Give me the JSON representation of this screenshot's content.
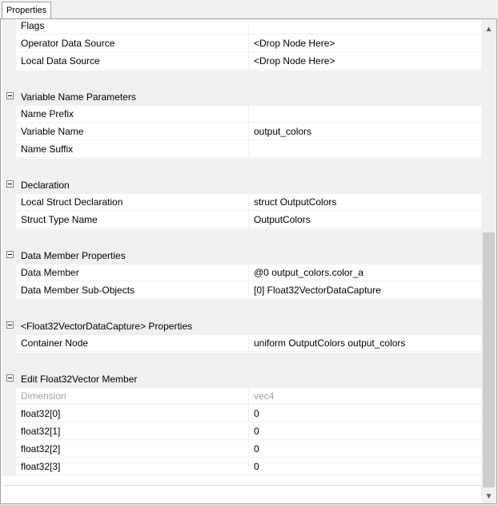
{
  "tab": {
    "label": "Properties"
  },
  "sections": [
    {
      "rows": [
        {
          "name": "Flags",
          "value": ""
        },
        {
          "name": "Operator Data Source",
          "value": "<Drop Node Here>"
        },
        {
          "name": "Local Data Source",
          "value": "<Drop Node Here>"
        }
      ]
    },
    {
      "title": "Variable Name Parameters",
      "rows": [
        {
          "name": "Name Prefix",
          "value": ""
        },
        {
          "name": "Variable Name",
          "value": "output_colors"
        },
        {
          "name": "Name Suffix",
          "value": ""
        }
      ]
    },
    {
      "title": "Declaration",
      "rows": [
        {
          "name": "Local Struct Declaration",
          "value": "struct OutputColors"
        },
        {
          "name": "Struct Type Name",
          "value": "OutputColors"
        }
      ]
    },
    {
      "title": "Data Member Properties",
      "rows": [
        {
          "name": "Data Member",
          "value": "@0 output_colors.color_a"
        },
        {
          "name": "Data Member Sub-Objects",
          "value": "[0] Float32VectorDataCapture"
        }
      ]
    },
    {
      "title": "<Float32VectorDataCapture> Properties",
      "rows": [
        {
          "name": "Container Node",
          "value": "uniform OutputColors output_colors"
        }
      ]
    },
    {
      "title": "Edit Float32Vector Member",
      "rows": [
        {
          "name": "Dimension",
          "value": "vec4",
          "disabled": true
        },
        {
          "name": "float32[0]",
          "value": "0"
        },
        {
          "name": "float32[1]",
          "value": "0"
        },
        {
          "name": "float32[2]",
          "value": "0"
        },
        {
          "name": "float32[3]",
          "value": "0"
        }
      ]
    }
  ],
  "icons": {
    "collapse": "collapse-icon",
    "scroll_up": "scroll-up-arrow-icon",
    "scroll_down": "scroll-down-arrow-icon"
  }
}
